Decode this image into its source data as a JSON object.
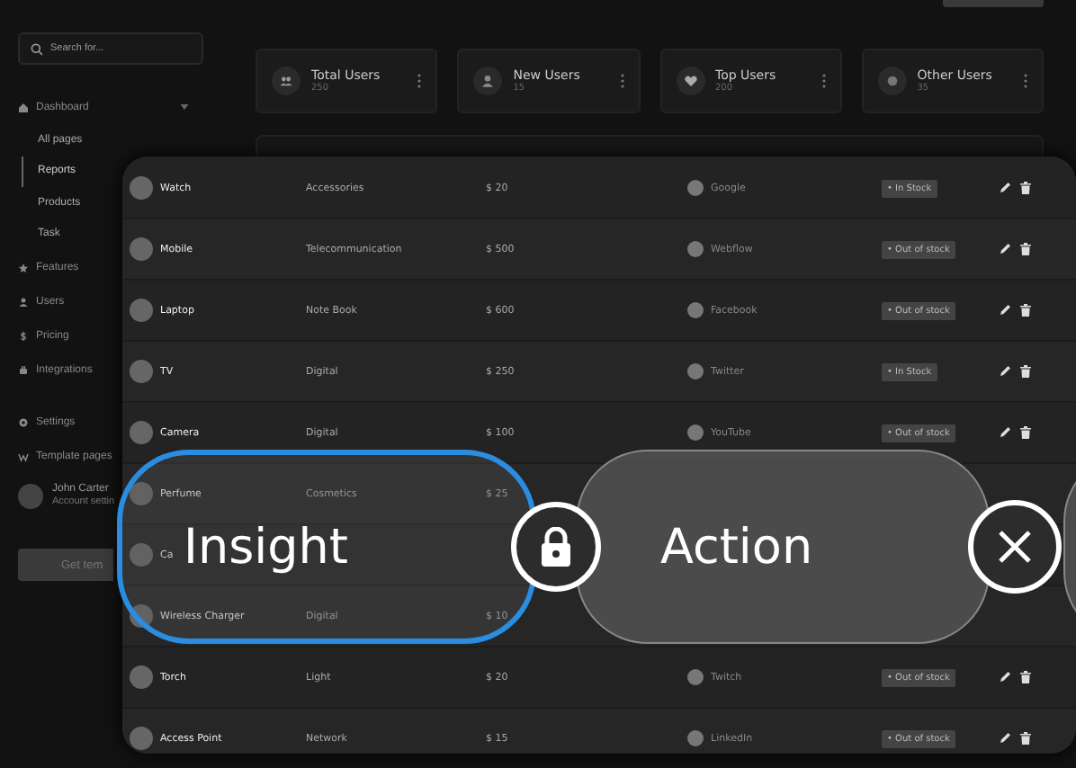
{
  "sidebar": {
    "search": {
      "placeholder": "Search for..."
    },
    "items": [
      {
        "label": "Dashboard",
        "expanded": true,
        "children": [
          {
            "label": "All pages",
            "selected": false
          },
          {
            "label": "Reports",
            "selected": true
          },
          {
            "label": "Products",
            "selected": false
          },
          {
            "label": "Task",
            "selected": false
          }
        ]
      },
      {
        "label": "Features"
      },
      {
        "label": "Users"
      },
      {
        "label": "Pricing"
      },
      {
        "label": "Integrations"
      }
    ],
    "footer_items": [
      {
        "label": "Settings"
      },
      {
        "label": "Template pages"
      }
    ],
    "account": {
      "name": "John Carter",
      "subtitle": "Account settin"
    },
    "button": "Get tem"
  },
  "stats": [
    {
      "title": "Total Users",
      "count": "250"
    },
    {
      "title": "New Users",
      "count": "15"
    },
    {
      "title": "Top Users",
      "count": "200"
    },
    {
      "title": "Other Users",
      "count": "35"
    }
  ],
  "table": {
    "rows": [
      {
        "product": "Watch",
        "category": "Accessories",
        "price": "$ 20",
        "company": "Google",
        "status": "• In Stock"
      },
      {
        "product": "Mobile",
        "category": "Telecommunication",
        "price": "$ 500",
        "company": "Webflow",
        "status": "• Out of stock"
      },
      {
        "product": "Laptop",
        "category": "Note Book",
        "price": "$ 600",
        "company": "Facebook",
        "status": "• Out of stock"
      },
      {
        "product": "TV",
        "category": "Digital",
        "price": "$ 250",
        "company": "Twitter",
        "status": "• In Stock"
      },
      {
        "product": "Camera",
        "category": "Digital",
        "price": "$ 100",
        "company": "YouTube",
        "status": "• Out of stock"
      },
      {
        "product": "Perfume",
        "category": "Cosmetics",
        "price": "$ 25"
      },
      {
        "product": "Ca"
      },
      {
        "product": "Wireless Charger",
        "category": "Digital",
        "price": "$ 10"
      },
      {
        "product": "Torch",
        "category": "Light",
        "price": "$ 20",
        "company": "Twitch",
        "status": "• Out of stock"
      },
      {
        "product": "Access Point",
        "category": "Network",
        "price": "$ 15",
        "company": "LinkedIn",
        "status": "• Out of stock"
      }
    ]
  },
  "overlay": {
    "pills": [
      {
        "label": "Insight",
        "selected": true
      },
      {
        "label": "Action",
        "selected": false
      },
      {
        "selected": false
      }
    ]
  }
}
